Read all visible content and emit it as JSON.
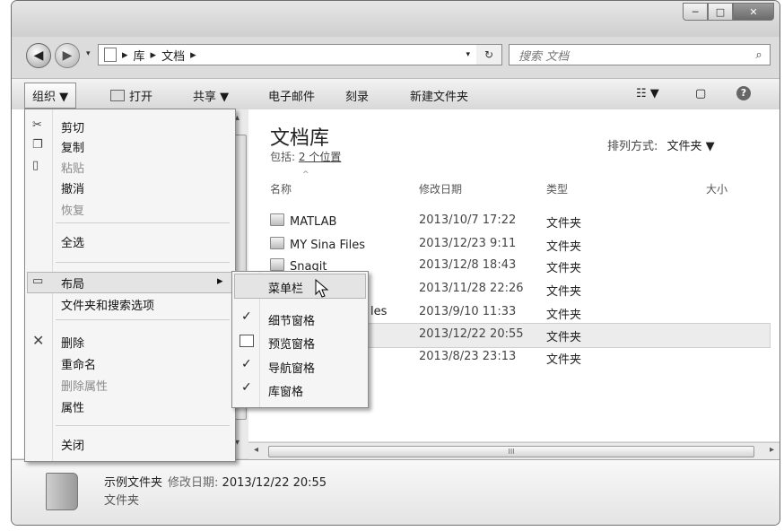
{
  "window": {
    "minimize": "─",
    "maximize": "□",
    "close": "✕"
  },
  "nav": {
    "back_icon": "◀",
    "forward_icon": "▶",
    "dropdown_icon": "▾"
  },
  "address": {
    "segments": [
      "库",
      "文档"
    ],
    "separator": "▸",
    "refresh_icon": "↻"
  },
  "search": {
    "placeholder": "搜索 文档",
    "icon": "⌕"
  },
  "toolbar": {
    "organize": "组织 ▼",
    "open": "打开",
    "share": "共享 ▼",
    "email": "电子邮件",
    "burn": "刻录",
    "new_folder": "新建文件夹",
    "views_icon": "☷ ▼",
    "preview_icon": "▢",
    "help_icon": "?"
  },
  "library": {
    "title": "文档库",
    "includes_label": "包括:",
    "includes_link": "2 个位置",
    "arrange_label": "排列方式:",
    "arrange_value": "文件夹 ▼"
  },
  "columns": {
    "name": "名称",
    "date": "修改日期",
    "type": "类型",
    "size": "大小"
  },
  "files": [
    {
      "name": "MATLAB",
      "date": "2013/10/7 17:22",
      "type": "文件夹"
    },
    {
      "name": "MY Sina Files",
      "date": "2013/12/23 9:11",
      "type": "文件夹"
    },
    {
      "name": "Snagit",
      "date": "2013/12/8 18:43",
      "type": "文件夹"
    },
    {
      "name": "",
      "date": "2013/11/28 22:26",
      "type": "文件夹"
    },
    {
      "name": "les",
      "date": "2013/9/10 11:33",
      "type": "文件夹"
    },
    {
      "name": "",
      "date": "2013/12/22 20:55",
      "type": "文件夹"
    },
    {
      "name": "",
      "date": "2013/8/23 23:13",
      "type": "文件夹"
    }
  ],
  "organize_menu": {
    "cut": "剪切",
    "copy": "复制",
    "paste": "粘贴",
    "undo": "撤消",
    "redo": "恢复",
    "select_all": "全选",
    "layout": "布局",
    "folder_options": "文件夹和搜索选项",
    "delete": "删除",
    "rename": "重命名",
    "remove_properties": "删除属性",
    "properties": "属性",
    "close": "关闭",
    "submenu_arrow": "▸"
  },
  "layout_submenu": {
    "menu_bar": "菜单栏",
    "details_pane": "细节窗格",
    "preview_pane": "预览窗格",
    "navigation_pane": "导航窗格",
    "library_pane": "库窗格",
    "check": "✓"
  },
  "details": {
    "name": "示例文件夹",
    "modified_label": "修改日期:",
    "modified_value": "2013/12/22 20:55",
    "type": "文件夹"
  },
  "scrollbar": {
    "left": "◂",
    "right": "▸",
    "grip": "III",
    "up": "▴",
    "down": "▾"
  }
}
